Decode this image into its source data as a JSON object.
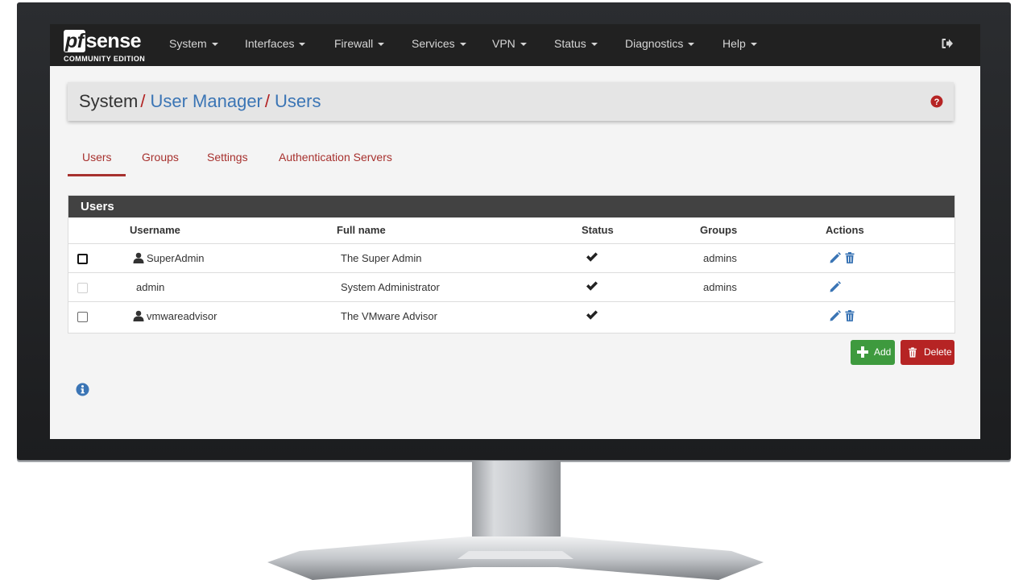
{
  "brand": {
    "logo_text": "pfsense",
    "logo_pf": "pf",
    "logo_sense": "sense",
    "edition": "COMMUNITY EDITION"
  },
  "nav": {
    "items": [
      {
        "label": "System"
      },
      {
        "label": "Interfaces"
      },
      {
        "label": "Firewall"
      },
      {
        "label": "Services"
      },
      {
        "label": "VPN"
      },
      {
        "label": "Status"
      },
      {
        "label": "Diagnostics"
      },
      {
        "label": "Help"
      }
    ],
    "logout_icon": "logout-icon"
  },
  "breadcrumb": {
    "items": [
      "System",
      "User Manager",
      "Users"
    ],
    "separator": "/",
    "help_icon": "question-circle-icon"
  },
  "tabs": [
    {
      "label": "Users",
      "active": true
    },
    {
      "label": "Groups",
      "active": false
    },
    {
      "label": "Settings",
      "active": false
    },
    {
      "label": "Authentication Servers",
      "active": false
    }
  ],
  "users_panel": {
    "title": "Users",
    "columns": [
      "Username",
      "Full name",
      "Status",
      "Groups",
      "Actions"
    ],
    "rows": [
      {
        "username": "SuperAdmin",
        "full_name": "The Super Admin",
        "enabled": true,
        "groups": "admins",
        "can_delete": true,
        "has_user_icon": true
      },
      {
        "username": "admin",
        "full_name": "System Administrator",
        "enabled": true,
        "groups": "admins",
        "can_delete": false,
        "has_user_icon": false
      },
      {
        "username": "vmwareadvisor",
        "full_name": "The VMware Advisor",
        "enabled": true,
        "groups": "",
        "can_delete": true,
        "has_user_icon": true
      }
    ]
  },
  "buttons": {
    "add": "Add",
    "delete": "Delete"
  },
  "colors": {
    "navbar": "#212121",
    "accent_red": "#a7312e",
    "link_blue": "#3b75b5",
    "add_green": "#3e9a3e",
    "delete_red": "#b62424",
    "panel_header": "#424242"
  }
}
